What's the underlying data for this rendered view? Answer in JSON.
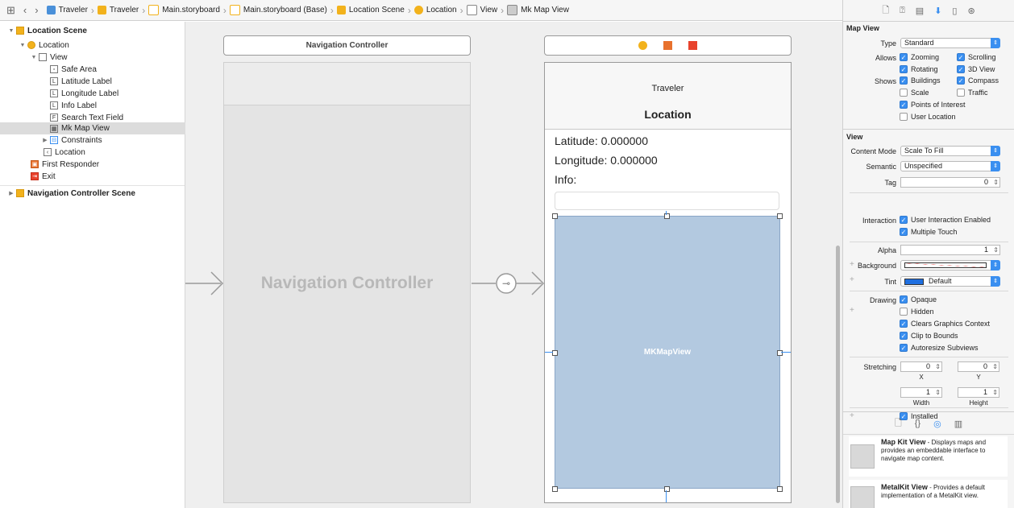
{
  "jumpbar": {
    "crumbs": [
      {
        "label": "Traveler",
        "icon": "project-icon",
        "color": "#4a90d9"
      },
      {
        "label": "Traveler",
        "icon": "folder-icon",
        "color": "#f2b21c"
      },
      {
        "label": "Main.storyboard",
        "icon": "storyboard-icon",
        "color": "#f2b21c"
      },
      {
        "label": "Main.storyboard (Base)",
        "icon": "storyboard-icon",
        "color": "#f2b21c"
      },
      {
        "label": "Location Scene",
        "icon": "scene-icon",
        "color": "#f2b21c"
      },
      {
        "label": "Location",
        "icon": "view-controller-icon",
        "color": "#f2b21c"
      },
      {
        "label": "View",
        "icon": "view-icon",
        "color": "#888888"
      },
      {
        "label": "Mk Map View",
        "icon": "map-view-icon",
        "color": "#888888"
      }
    ]
  },
  "outline": {
    "location_scene": "Location Scene",
    "location": "Location",
    "view": "View",
    "safe_area": "Safe Area",
    "latitude_label": "Latitude Label",
    "longitude_label": "Longitude Label",
    "info_label": "Info Label",
    "search_text_field": "Search Text Field",
    "mk_map_view": "Mk Map View",
    "constraints": "Constraints",
    "location_segue": "Location",
    "first_responder": "First Responder",
    "exit": "Exit",
    "nav_scene": "Navigation Controller Scene"
  },
  "canvas": {
    "nav_title_bar": "Navigation Controller",
    "nav_placeholder": "Navigation Controller",
    "app_name": "Traveler",
    "nav_title": "Location",
    "latitude": "Latitude: 0.000000",
    "longitude": "Longitude: 0.000000",
    "info": "Info:",
    "mapview": "MKMapView"
  },
  "inspector": {
    "mapview_header": "Map View",
    "type_label": "Type",
    "type_value": "Standard",
    "allows_label": "Allows",
    "zooming": "Zooming",
    "scrolling": "Scrolling",
    "rotating": "Rotating",
    "view3d": "3D View",
    "shows_label": "Shows",
    "buildings": "Buildings",
    "compass": "Compass",
    "scale": "Scale",
    "traffic": "Traffic",
    "poi": "Points of Interest",
    "user_location": "User Location",
    "view_header": "View",
    "content_mode_label": "Content Mode",
    "content_mode_value": "Scale To Fill",
    "semantic_label": "Semantic",
    "semantic_value": "Unspecified",
    "tag_label": "Tag",
    "tag_value": "0",
    "interaction_label": "Interaction",
    "user_interaction": "User Interaction Enabled",
    "multiple_touch": "Multiple Touch",
    "alpha_label": "Alpha",
    "alpha_value": "1",
    "background_label": "Background",
    "tint_label": "Tint",
    "tint_value": "Default",
    "drawing_label": "Drawing",
    "opaque": "Opaque",
    "hidden": "Hidden",
    "clears_graphics": "Clears Graphics Context",
    "clip_bounds": "Clip to Bounds",
    "autoresize": "Autoresize Subviews",
    "stretching_label": "Stretching",
    "stretch_x": "0",
    "stretch_y": "0",
    "x_label": "X",
    "y_label": "Y",
    "stretch_w": "1",
    "stretch_h": "1",
    "width_label": "Width",
    "height_label": "Height",
    "installed": "Installed",
    "lib1_title": "Map Kit View",
    "lib1_desc": " - Displays maps and provides an embeddable interface to navigate map content.",
    "lib2_title": "MetalKit View",
    "lib2_desc": " - Provides a default implementation of a MetalKit view."
  },
  "colors": {
    "accent": "#3a8ff0",
    "mapview_fill": "#b3c9e0",
    "selection": "#dcdcdc"
  }
}
